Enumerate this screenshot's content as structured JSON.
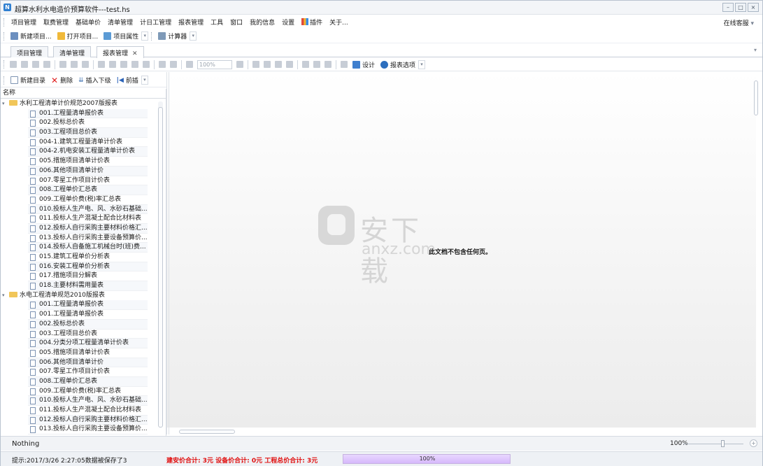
{
  "window": {
    "title": "超算水利水电造价预算软件---test.hs",
    "controls": [
      "–",
      "□",
      "×"
    ]
  },
  "menu": {
    "items": [
      "项目管理",
      "取费管理",
      "基础单价",
      "清单管理",
      "计日工管理",
      "报表管理",
      "工具",
      "窗口",
      "我的信息",
      "设置",
      "插件",
      "关于..."
    ],
    "service": "在线客服"
  },
  "toolbar1": {
    "new_project": "新建项目...",
    "open_project": "打开项目...",
    "project_props": "项目属性",
    "calculator": "计算器"
  },
  "tabs": {
    "items": [
      "项目管理",
      "清单管理",
      "报表管理"
    ],
    "active_index": 2
  },
  "preview_toolbar": {
    "zoom": "100%",
    "design": "设计",
    "report_options": "报表选项"
  },
  "report_toolbar": {
    "new_dir": "新建目录",
    "delete": "删除",
    "insert_sub": "插入下级",
    "prev_insert": "前插"
  },
  "tree": {
    "column": "名称",
    "groups": [
      {
        "label": "水利工程清单计价规范2007版报表",
        "items": [
          "001.工程量清单报价表",
          "002.投标总价表",
          "003.工程项目总价表",
          "004-1.建筑工程量清单计价表",
          "004-2.机电安装工程量清单计价表",
          "005.措施项目清单计价表",
          "006.其他项目清单计价",
          "007.零星工作项目计价表",
          "008.工程单价汇总表",
          "009.工程单价费(税)率汇总表",
          "010.投标人生产电、风、水砂石基础...",
          "011.投标人生产混凝土配合比材料表",
          "012.投标人自行采购主要材料价格汇...",
          "013.投标人自行采购主要设备预算价...",
          "014.投标人自备施工机械台时(班)费...",
          "015.建筑工程单价分析表",
          "016.安装工程单价分析表",
          "017.措施项目分解表",
          "018.主要材料需用量表"
        ]
      },
      {
        "label": "水电工程清单规范2010版报表",
        "items": [
          "001.工程量清单报价表",
          "001.工程量清单报价表",
          "002.投标总价表",
          "003.工程项目总价表",
          "004.分类分项工程量清单计价表",
          "005.措施项目清单计价表",
          "006.其他项目清单计价",
          "007.零星工作项目计价表",
          "008.工程单价汇总表",
          "009.工程单价费(税)率汇总表",
          "010.投标人生产电、风、水砂石基础...",
          "011.投标人生产混凝土配合比材料表",
          "012.投标人自行采购主要材料价格汇...",
          "013.投标人自行采购主要设备预算价..."
        ]
      }
    ]
  },
  "main": {
    "message": "此文档不包含任何页。",
    "watermark_cn": "安下载",
    "watermark_en": "anxz.com"
  },
  "status": {
    "left": "Nothing",
    "zoom": "100%",
    "hint": "提示:2017/3/26 2:27:05数据被保存了3",
    "totals": "建安价合计: 3元  设备价合计: 0元  工程总价合计: 3元",
    "progress_label": "100%",
    "progress_value": 1.0
  }
}
